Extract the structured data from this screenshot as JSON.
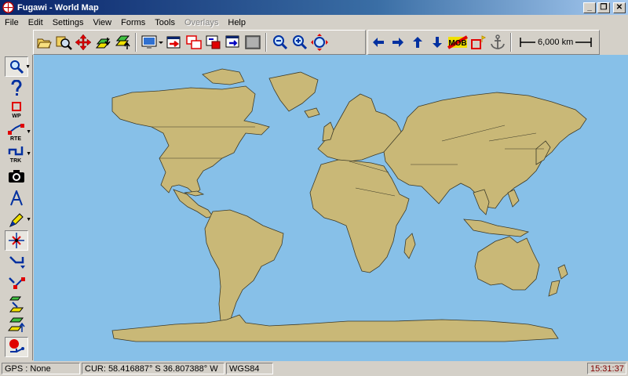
{
  "window": {
    "title": "Fugawi - World Map",
    "minimize_label": "_",
    "maximize_label": "❐",
    "close_label": "✕"
  },
  "menu": {
    "items": [
      "File",
      "Edit",
      "Settings",
      "View",
      "Forms",
      "Tools",
      "Overlays",
      "Help"
    ],
    "disabled_items": [
      "Overlays"
    ]
  },
  "toolbar": {
    "icons": [
      "open-folder-icon",
      "find-map-icon",
      "move-map-icon",
      "import-icon",
      "export-icon",
      "display-icon",
      "map-window-icon",
      "send-to-icon",
      "map-frame-icon",
      "map-sheet-icon",
      "gray-map-icon",
      "zoom-out-icon",
      "zoom-in-icon",
      "zoom-fit-icon"
    ],
    "nav_icons": [
      "arrow-left-icon",
      "arrow-right-icon",
      "arrow-up-icon",
      "arrow-down-icon",
      "mob-icon",
      "waypoint-flag-icon",
      "anchor-icon"
    ],
    "mob_label": "MOB",
    "scale_label": "6,000 km"
  },
  "left_toolbar": {
    "tools": [
      "magnify-icon",
      "help-icon",
      "waypoint-icon",
      "route-icon",
      "track-icon",
      "camera-icon",
      "text-icon",
      "pen-icon",
      "select-icon",
      "route-transfer-icon",
      "route-transfer-down-icon",
      "overlay-down-icon",
      "overlay-up-icon",
      "gps-record-icon"
    ],
    "wp_label": "WP",
    "rte_label": "RTE",
    "trk_label": "TRK"
  },
  "map": {
    "name": "World Map",
    "ocean_color": "#87c0e8",
    "land_color": "#c9b877",
    "border_color": "#3c3a28"
  },
  "status": {
    "gps": "GPS : None",
    "cursor": "CUR: 58.416887° S 36.807388° W",
    "datum": "WGS84",
    "time": "15:31:37"
  }
}
